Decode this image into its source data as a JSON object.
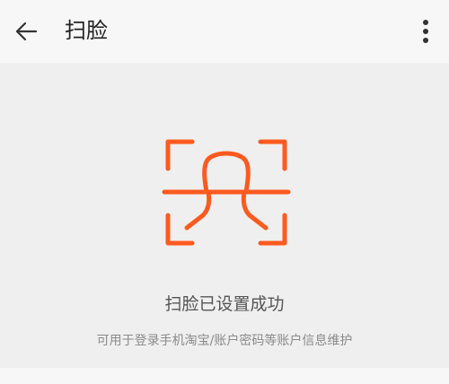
{
  "header": {
    "title": "扫脸",
    "back_icon": "arrow-left-icon",
    "menu_icon": "more-vertical-icon"
  },
  "content": {
    "icon": "face-scan-icon",
    "accent_color": "#ff5a1f",
    "status_title": "扫脸已设置成功",
    "status_description": "可用于登录手机淘宝/账户密码等账户信息维护"
  }
}
